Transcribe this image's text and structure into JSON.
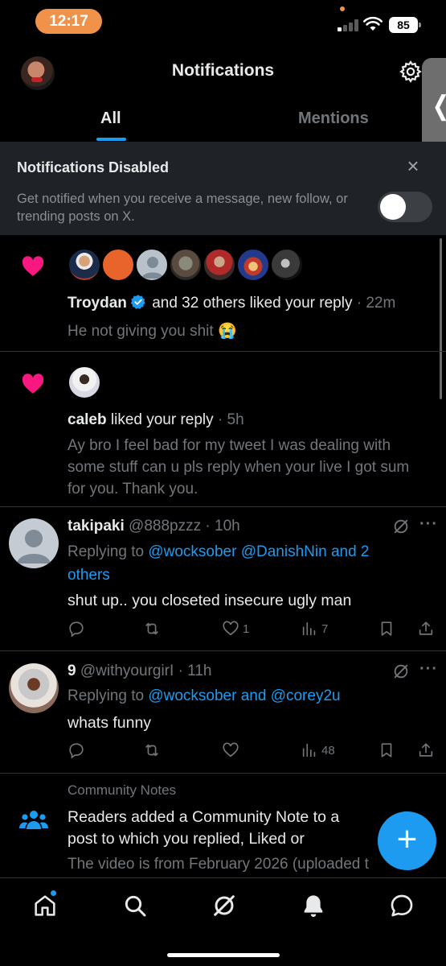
{
  "status_bar": {
    "time": "12:17",
    "battery": "85"
  },
  "header": {
    "title": "Notifications"
  },
  "tabs": [
    {
      "label": "All"
    },
    {
      "label": "Mentions"
    }
  ],
  "banner": {
    "title": "Notifications Disabled",
    "text": "Get notified when you receive a message, new follow, or trending posts on X.",
    "close": "×"
  },
  "notifications": [
    {
      "name": "Troydan",
      "action": "and 32 others liked your reply",
      "time": "· 22m",
      "text": "He not giving you shit 😭"
    },
    {
      "name": "caleb",
      "action": "liked your reply",
      "time": "· 5h",
      "text": "Ay bro I feel bad for my tweet I was dealing with some stuff can u pls reply when your live I got sum for you. Thank you."
    }
  ],
  "posts": [
    {
      "name": "takipaki",
      "handle": "@888pzzz",
      "time": "· 10h",
      "replying_prefix": "Replying to",
      "replying_to": "@wocksober @DanishNin and 2 others",
      "body": "shut up.. you closeted insecure ugly man",
      "likes": "1",
      "views": "7"
    },
    {
      "name": "9",
      "handle": "@withyourgirI",
      "time": "· 11h",
      "replying_prefix": "Replying to",
      "replying_to": "@wocksober and @corey2u",
      "body": "whats funny",
      "likes": "",
      "views": "48"
    }
  ],
  "community_note": {
    "label": "Community Notes",
    "text": "Readers added a Community Note to a post to which you replied, Liked or",
    "sub": "The video is from February 2026 (uploaded t"
  },
  "more_label": "···",
  "fab_label": "+",
  "colors": {
    "accent": "#1d9bf0",
    "like": "#f91880",
    "banner_bg": "#1f2226"
  }
}
